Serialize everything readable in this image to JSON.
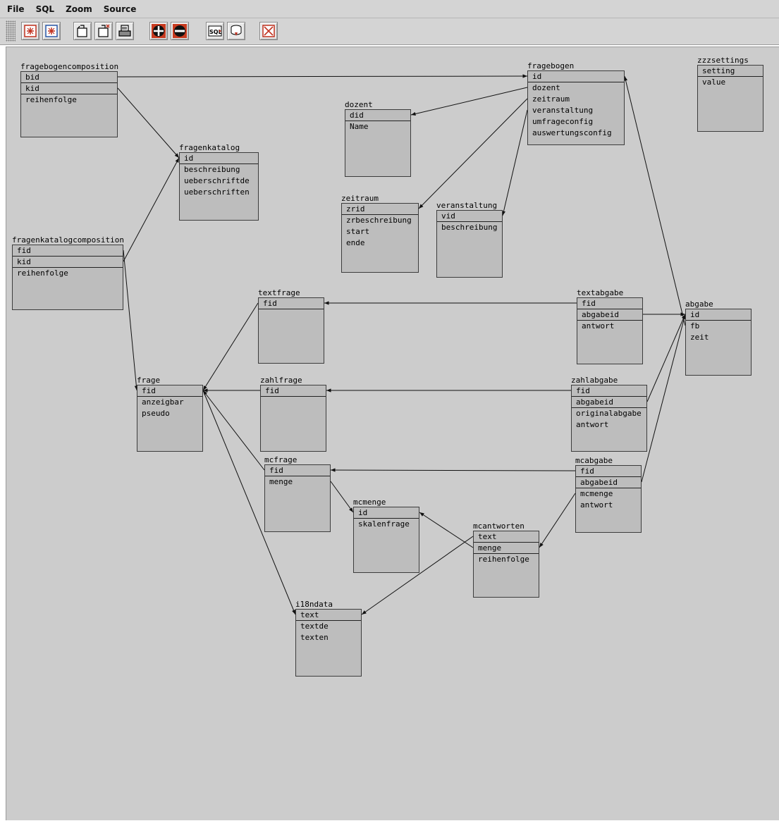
{
  "menu": [
    "File",
    "SQL",
    "Zoom",
    "Source"
  ],
  "toolbar": {
    "buttons": [
      "new-table-icon",
      "new-table-alt-icon",
      "open-icon",
      "open-new-icon",
      "print-icon",
      "zoom-in-icon",
      "zoom-out-icon",
      "sql-export-icon",
      "database-import-icon",
      "close-icon"
    ]
  },
  "tables": [
    {
      "name": "fragebogencomposition",
      "fields": [
        "bid",
        "kid",
        "reihenfolge"
      ]
    },
    {
      "name": "fragenkatalog",
      "fields": [
        "id",
        "beschreibung",
        "ueberschriftde",
        "ueberschriften"
      ]
    },
    {
      "name": "fragenkatalogcomposition",
      "fields": [
        "fid",
        "kid",
        "reihenfolge"
      ]
    },
    {
      "name": "fragebogen",
      "fields": [
        "id",
        "dozent",
        "zeitraum",
        "veranstaltung",
        "umfrageconfig",
        "auswertungsconfig"
      ]
    },
    {
      "name": "dozent",
      "fields": [
        "did",
        "Name"
      ]
    },
    {
      "name": "zeitraum",
      "fields": [
        "zrid",
        "zrbeschreibung",
        "start",
        "ende"
      ]
    },
    {
      "name": "veranstaltung",
      "fields": [
        "vid",
        "beschreibung"
      ]
    },
    {
      "name": "zzzsettings",
      "fields": [
        "setting",
        "value"
      ]
    },
    {
      "name": "textfrage",
      "fields": [
        "fid"
      ]
    },
    {
      "name": "textabgabe",
      "fields": [
        "fid",
        "abgabeid",
        "antwort"
      ]
    },
    {
      "name": "abgabe",
      "fields": [
        "id",
        "fb",
        "zeit"
      ]
    },
    {
      "name": "frage",
      "fields": [
        "fid",
        "anzeigbar",
        "pseudo"
      ]
    },
    {
      "name": "zahlfrage",
      "fields": [
        "fid"
      ]
    },
    {
      "name": "zahlabgabe",
      "fields": [
        "fid",
        "abgabeid",
        "originalabgabe",
        "antwort"
      ]
    },
    {
      "name": "mcfrage",
      "fields": [
        "fid",
        "menge"
      ]
    },
    {
      "name": "mcabgabe",
      "fields": [
        "fid",
        "abgabeid",
        "mcmenge",
        "antwort"
      ]
    },
    {
      "name": "mcmenge",
      "fields": [
        "id",
        "skalenfrage"
      ]
    },
    {
      "name": "mcantworten",
      "fields": [
        "text",
        "menge",
        "reihenfolge"
      ]
    },
    {
      "name": "i18ndata",
      "fields": [
        "text",
        "textde",
        "texten"
      ]
    }
  ]
}
